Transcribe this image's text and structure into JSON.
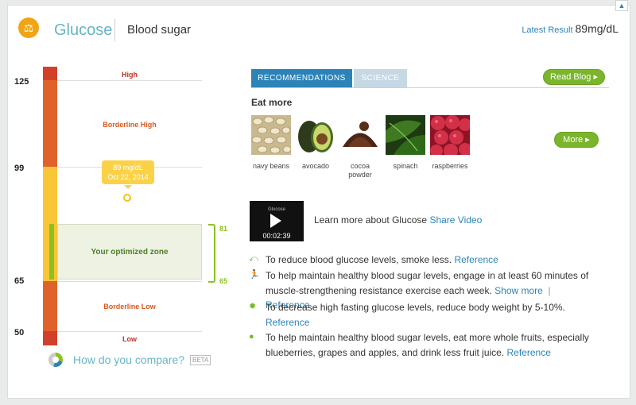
{
  "header": {
    "title": "Glucose",
    "subtitle": "Blood sugar",
    "latest_label": "Latest Result",
    "latest_value": "89mg/dL"
  },
  "scale": {
    "y_labels": [
      "125",
      "99",
      "65",
      "50"
    ],
    "ranges": {
      "high": "High",
      "borderline_high": "Borderline High",
      "optimized": "Your optimized zone",
      "borderline_low": "Borderline Low",
      "low": "Low"
    },
    "bracket_top": "81",
    "bracket_bottom": "65",
    "tooltip_value": "89 mg/dL",
    "tooltip_date": "Oct 22, 2014",
    "colors": {
      "high": "#d2402a",
      "borderline": "#e0622a",
      "normal": "#f8c636",
      "optimized": "#8bc220"
    }
  },
  "compare": {
    "label": "How do you compare?",
    "badge": "BETA"
  },
  "tabs": [
    {
      "label": "RECOMMENDATIONS"
    },
    {
      "label": "SCIENCE"
    }
  ],
  "buttons": {
    "read_blog": "Read Blog",
    "more": "More"
  },
  "eat_more": {
    "heading": "Eat more",
    "foods": [
      {
        "name": "navy beans",
        "icon": "navy-beans-image"
      },
      {
        "name": "avocado",
        "icon": "avocado-image"
      },
      {
        "name": "cocoa powder",
        "icon": "cocoa-powder-image"
      },
      {
        "name": "spinach",
        "icon": "spinach-image"
      },
      {
        "name": "raspberries",
        "icon": "raspberries-image"
      }
    ]
  },
  "video": {
    "thumb_title": "Glucose",
    "duration": "00:02:39",
    "learn_text": "Learn more about Glucose",
    "share_label": "Share Video"
  },
  "recommendations": [
    {
      "icon": "smoke-icon",
      "text": "To reduce blood glucose levels, smoke less.",
      "links": [
        "Reference"
      ]
    },
    {
      "icon": "exercise-icon",
      "text": "To help maintain healthy blood sugar levels, engage in at least 60 minutes of muscle-strengthening resistance exercise each week.",
      "links": [
        "Show more",
        "Reference"
      ]
    },
    {
      "icon": "sun-icon",
      "text": "To decrease high fasting glucose levels, reduce body weight by 5-10%.",
      "links": [
        "Reference"
      ]
    },
    {
      "icon": "apple-icon",
      "text": "To help maintain healthy blood sugar levels, eat more whole fruits, especially blueberries, grapes and apples, and drink less fruit juice.",
      "links": [
        "Reference"
      ]
    }
  ]
}
